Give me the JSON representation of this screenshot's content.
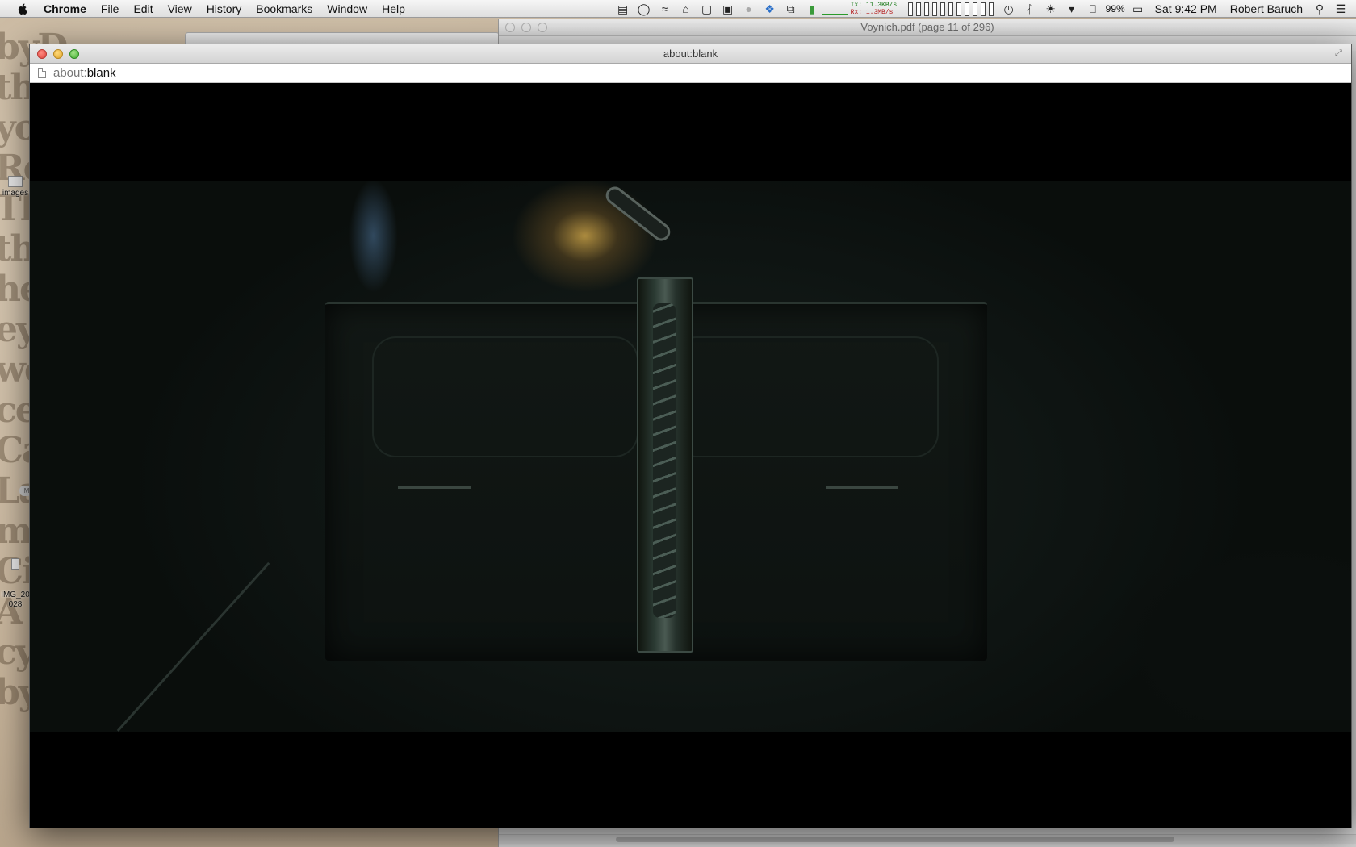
{
  "menubar": {
    "app_name": "Chrome",
    "items": [
      "File",
      "Edit",
      "View",
      "History",
      "Bookmarks",
      "Window",
      "Help"
    ],
    "status": {
      "net_tx": "Tx:  11.3KB/s",
      "net_rx": "Rx:  1.3MB/s",
      "battery_percent": "99%",
      "clock": "Sat 9:42 PM",
      "user": "Robert Baruch"
    },
    "icons": [
      "books-icon",
      "headphones-icon",
      "wifi-signal-icon",
      "home-icon",
      "document-alert-icon",
      "terminal-icon",
      "notification-bell-icon",
      "dropbox-icon",
      "copy-icon",
      "memory-bars-icon",
      "time-machine-icon",
      "bluetooth-icon",
      "wifi-icon",
      "volume-icon",
      "input-source-icon",
      "battery-icon",
      "spotlight-icon",
      "list-icon"
    ]
  },
  "desktop": {
    "icons": [
      {
        "label": "images"
      },
      {
        "label": "IMG_20\n028"
      }
    ],
    "parchment_text": "byD\nthe\nyour\nRe\nTh\nthy\nhe\ney\nwes\nce\nCa\nLa\nme\nCi\nA\ncy\nby",
    "badge": "IM"
  },
  "preview_window": {
    "title": "Voynich.pdf (page 11 of 296)"
  },
  "chrome_window": {
    "title": "about:blank",
    "url_scheme": "about:",
    "url_rest": "blank"
  },
  "colors": {
    "close": "#e0443e",
    "minimize": "#e0a52a",
    "maximize": "#3fae2f"
  }
}
